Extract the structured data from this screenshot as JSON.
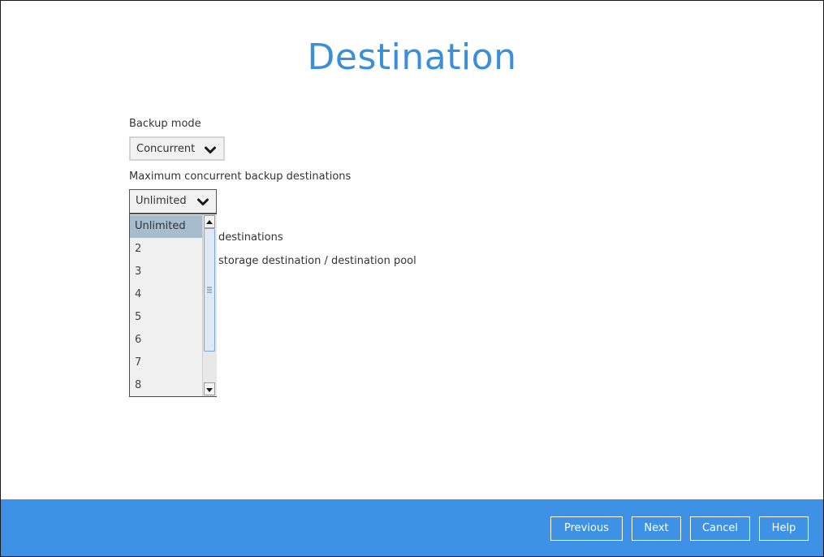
{
  "page": {
    "title": "Destination"
  },
  "backup_mode": {
    "label": "Backup mode",
    "selected": "Concurrent"
  },
  "max_concurrent": {
    "label": "Maximum concurrent backup destinations",
    "selected": "Unlimited",
    "options": [
      "Unlimited",
      "2",
      "3",
      "4",
      "5",
      "6",
      "7",
      "8"
    ]
  },
  "background": {
    "line1_fragment": "destinations",
    "line2_fragment": "storage destination / destination pool"
  },
  "footer": {
    "previous_label": "Previous",
    "next_label": "Next",
    "cancel_label": "Cancel",
    "help_label": "Help"
  },
  "colors": {
    "accent": "#3b8fd9",
    "footer_bg": "#3d92e6",
    "selected_option": "#a7bccc"
  }
}
